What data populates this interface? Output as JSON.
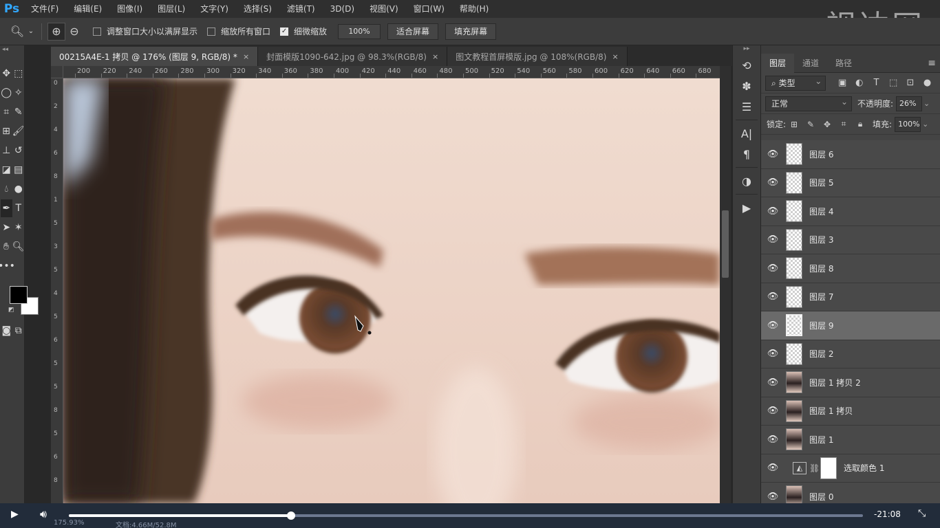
{
  "app": {
    "logo": "Ps",
    "watermark": "视达网"
  },
  "menu": [
    "文件(F)",
    "编辑(E)",
    "图像(I)",
    "图层(L)",
    "文字(Y)",
    "选择(S)",
    "滤镜(T)",
    "3D(D)",
    "视图(V)",
    "窗口(W)",
    "帮助(H)"
  ],
  "options": {
    "resize_windows_label": "调整窗口大小以满屏显示",
    "zoom_all_label": "缩放所有窗口",
    "scrubby_zoom_label": "细微缩放",
    "zoom_value": "100%",
    "fit_screen_label": "适合屏幕",
    "fill_screen_label": "填充屏幕"
  },
  "tabs": [
    {
      "title": "00215A4E-1 拷贝 @ 176% (图层 9, RGB/8) *",
      "close": "×"
    },
    {
      "title": "封面模版1090-642.jpg @ 98.3%(RGB/8)",
      "close": "×"
    },
    {
      "title": "图文教程首屏模版.jpg @ 108%(RGB/8)",
      "close": "×"
    }
  ],
  "ruler_top": [
    "200",
    "220",
    "240",
    "260",
    "280",
    "300",
    "320",
    "340",
    "360",
    "380",
    "400",
    "420",
    "440",
    "460",
    "480",
    "500",
    "520",
    "540",
    "560",
    "580",
    "600",
    "620",
    "640",
    "660",
    "680"
  ],
  "ruler_left": [
    "0",
    "2",
    "4",
    "6",
    "8",
    "1",
    "5",
    "3",
    "5",
    "4",
    "5",
    "6",
    "5",
    "5",
    "8",
    "5",
    "6",
    "8"
  ],
  "layers_panel": {
    "tabs": [
      "图层",
      "通道",
      "路径"
    ],
    "filter_kind": "类型",
    "blend_mode": "正常",
    "opacity_label": "不透明度:",
    "opacity_value": "26%",
    "lock_label": "锁定:",
    "fill_label": "填充:",
    "fill_value": "100%",
    "layers": [
      {
        "name": "图层 6",
        "type": "blank",
        "selected": false
      },
      {
        "name": "图层 5",
        "type": "blank",
        "selected": false
      },
      {
        "name": "图层 4",
        "type": "blank",
        "selected": false
      },
      {
        "name": "图层 3",
        "type": "blank",
        "selected": false
      },
      {
        "name": "图层 8",
        "type": "blank",
        "selected": false
      },
      {
        "name": "图层 7",
        "type": "blank",
        "selected": false
      },
      {
        "name": "图层 9",
        "type": "blank",
        "selected": true
      },
      {
        "name": "图层 2",
        "type": "blank",
        "selected": false
      },
      {
        "name": "图层 1 拷贝 2",
        "type": "photo",
        "selected": false
      },
      {
        "name": "图层 1 拷贝",
        "type": "photo",
        "selected": false
      },
      {
        "name": "图层 1",
        "type": "photo",
        "selected": false
      },
      {
        "name": "选取颜色 1",
        "type": "adjustment",
        "selected": false
      },
      {
        "name": "图层 0",
        "type": "photo",
        "selected": false
      }
    ]
  },
  "status": {
    "zoom": "175.93%",
    "doc": "文档:4.66M/52.8M"
  },
  "video": {
    "time_remaining": "-21:08",
    "progress": 0.28
  },
  "colors": {
    "accent": "#31a8ff",
    "foreground": "#000000",
    "background": "#ffffff"
  }
}
